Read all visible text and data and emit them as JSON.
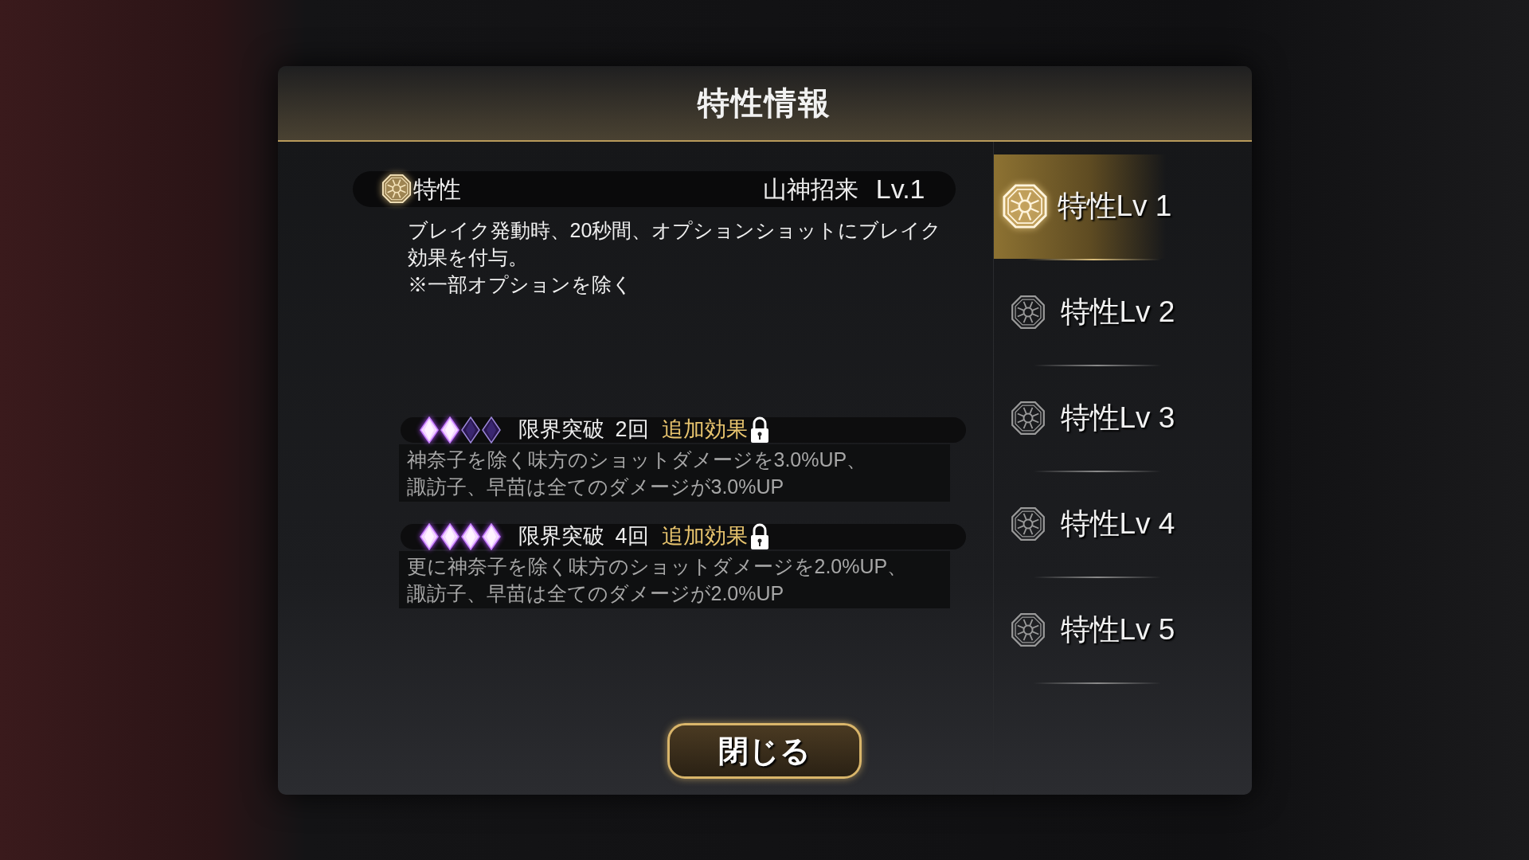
{
  "title": "特性情報",
  "trait": {
    "label": "特性",
    "name": "山神招来",
    "level": "Lv.1",
    "description": "ブレイク発動時、20秒間、オプションショットにブレイク効果を付与。\n※一部オプションを除く"
  },
  "limit_breaks": [
    {
      "gems": [
        {
          "lit": true
        },
        {
          "lit": true
        },
        {
          "lit": false
        },
        {
          "lit": false
        }
      ],
      "label": "限界突破",
      "count": "2回",
      "bonus": "追加効果",
      "locked": true,
      "description": [
        "神奈子を除く味方のショットダメージを3.0%UP、",
        "諏訪子、早苗は全てのダメージが3.0%UP"
      ]
    },
    {
      "gems": [
        {
          "lit": true
        },
        {
          "lit": true
        },
        {
          "lit": true
        },
        {
          "lit": true
        }
      ],
      "label": "限界突破",
      "count": "4回",
      "bonus": "追加効果",
      "locked": true,
      "description": [
        "更に神奈子を除く味方のショットダメージを2.0%UP、",
        "諏訪子、早苗は全てのダメージが2.0%UP"
      ]
    }
  ],
  "levels": [
    {
      "label": "特性Lv 1",
      "selected": true
    },
    {
      "label": "特性Lv 2",
      "selected": false
    },
    {
      "label": "特性Lv 3",
      "selected": false
    },
    {
      "label": "特性Lv 4",
      "selected": false
    },
    {
      "label": "特性Lv 5",
      "selected": false
    }
  ],
  "close_button": "閉じる"
}
